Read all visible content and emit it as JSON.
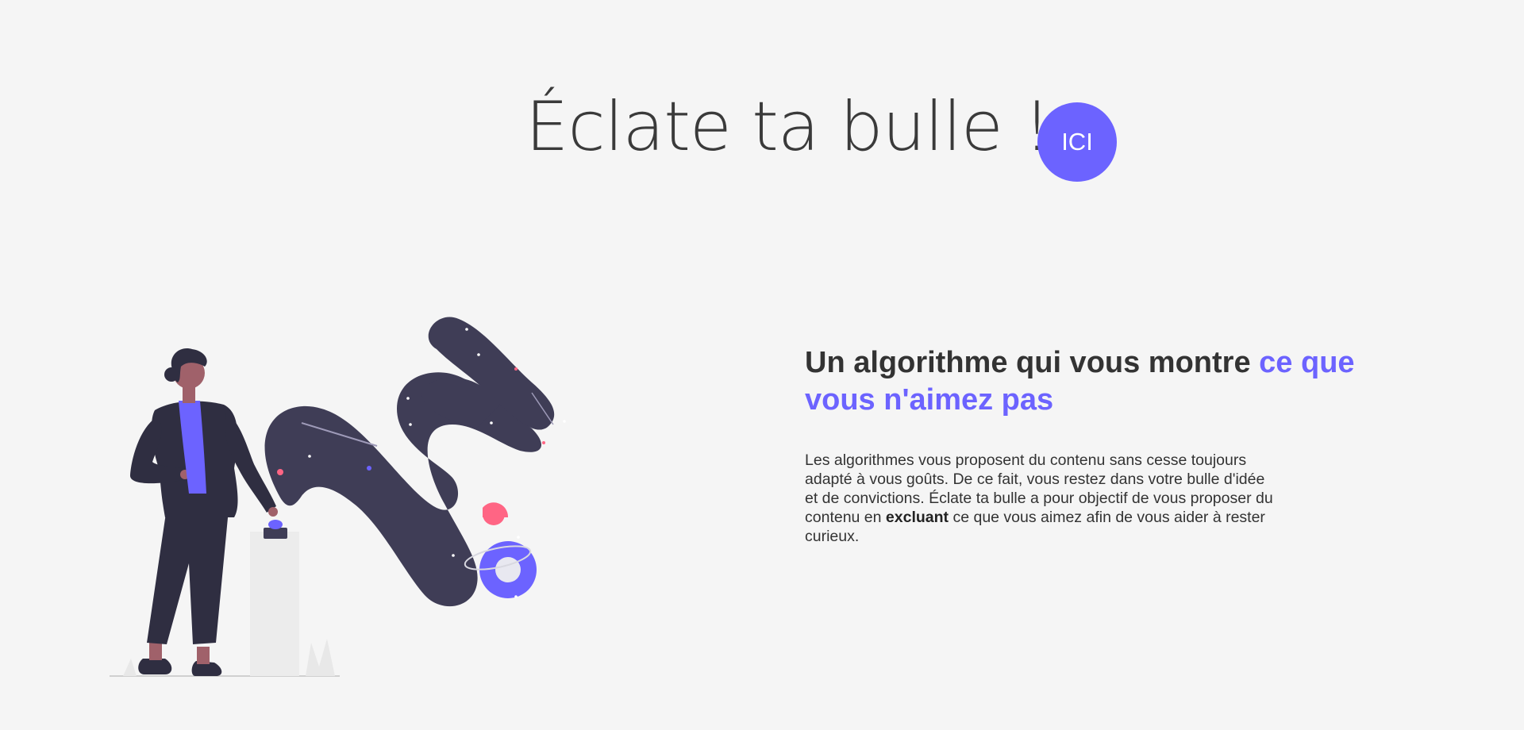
{
  "hero": {
    "title": "Éclate ta bulle !",
    "cta_label": "ICI"
  },
  "section": {
    "heading_part1": "Un algorithme qui vous montre ",
    "heading_highlight": "ce que vous n'aimez pas",
    "text_part1": "Les algorithmes vous proposent du contenu sans cesse toujours adapté à vous goûts. De ce fait, vous restez dans votre bulle d'idée et de convictions. Éclate ta bulle a pour objectif de vous proposer du contenu en ",
    "text_bold": "excluant",
    "text_part2": " ce que vous aimez afin de vous aider à rester curieux."
  },
  "illustration": {
    "icon": "person-pressing-button-space-illustration"
  },
  "colors": {
    "background": "#f5f5f5",
    "accent": "#6c63ff",
    "text": "#333333",
    "dark": "#3f3d56",
    "pink": "#ff6584"
  }
}
